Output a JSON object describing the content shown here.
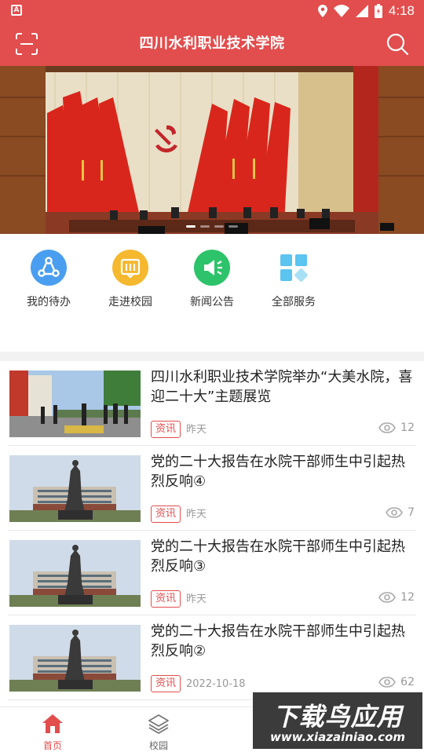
{
  "status_bar": {
    "time": "4:18"
  },
  "header": {
    "title": "四川水利职业技术学院"
  },
  "banner": {
    "slide_count": 4,
    "active_slide": 1
  },
  "services": [
    {
      "label": "我的待办",
      "icon": "share-nodes-icon",
      "color": "#4a9ef0"
    },
    {
      "label": "走进校园",
      "icon": "book-icon",
      "color": "#f5b82e"
    },
    {
      "label": "新闻公告",
      "icon": "megaphone-icon",
      "color": "#2dc36a"
    },
    {
      "label": "全部服务",
      "icon": "grid-icon",
      "color": "#5bc4f0"
    }
  ],
  "news": [
    {
      "title": "四川水利职业技术学院举办“大美水院，喜迎二十大”主题展览",
      "tag": "资讯",
      "date": "昨天",
      "views": "12"
    },
    {
      "title": "党的二十大报告在水院干部师生中引起热烈反响④",
      "tag": "资讯",
      "date": "昨天",
      "views": "7"
    },
    {
      "title": "党的二十大报告在水院干部师生中引起热烈反响③",
      "tag": "资讯",
      "date": "昨天",
      "views": "12"
    },
    {
      "title": "党的二十大报告在水院干部师生中引起热烈反响②",
      "tag": "资讯",
      "date": "2022-10-18",
      "views": "62"
    }
  ],
  "bottom_nav": [
    {
      "label": "首页",
      "icon": "home-icon",
      "active": true
    },
    {
      "label": "校园",
      "icon": "layers-icon",
      "active": false
    }
  ],
  "watermark": {
    "line1": "下载鸟应用",
    "line2": "www.xiazainiao.com"
  },
  "colors": {
    "accent": "#e24d4d",
    "muted": "#999999"
  }
}
